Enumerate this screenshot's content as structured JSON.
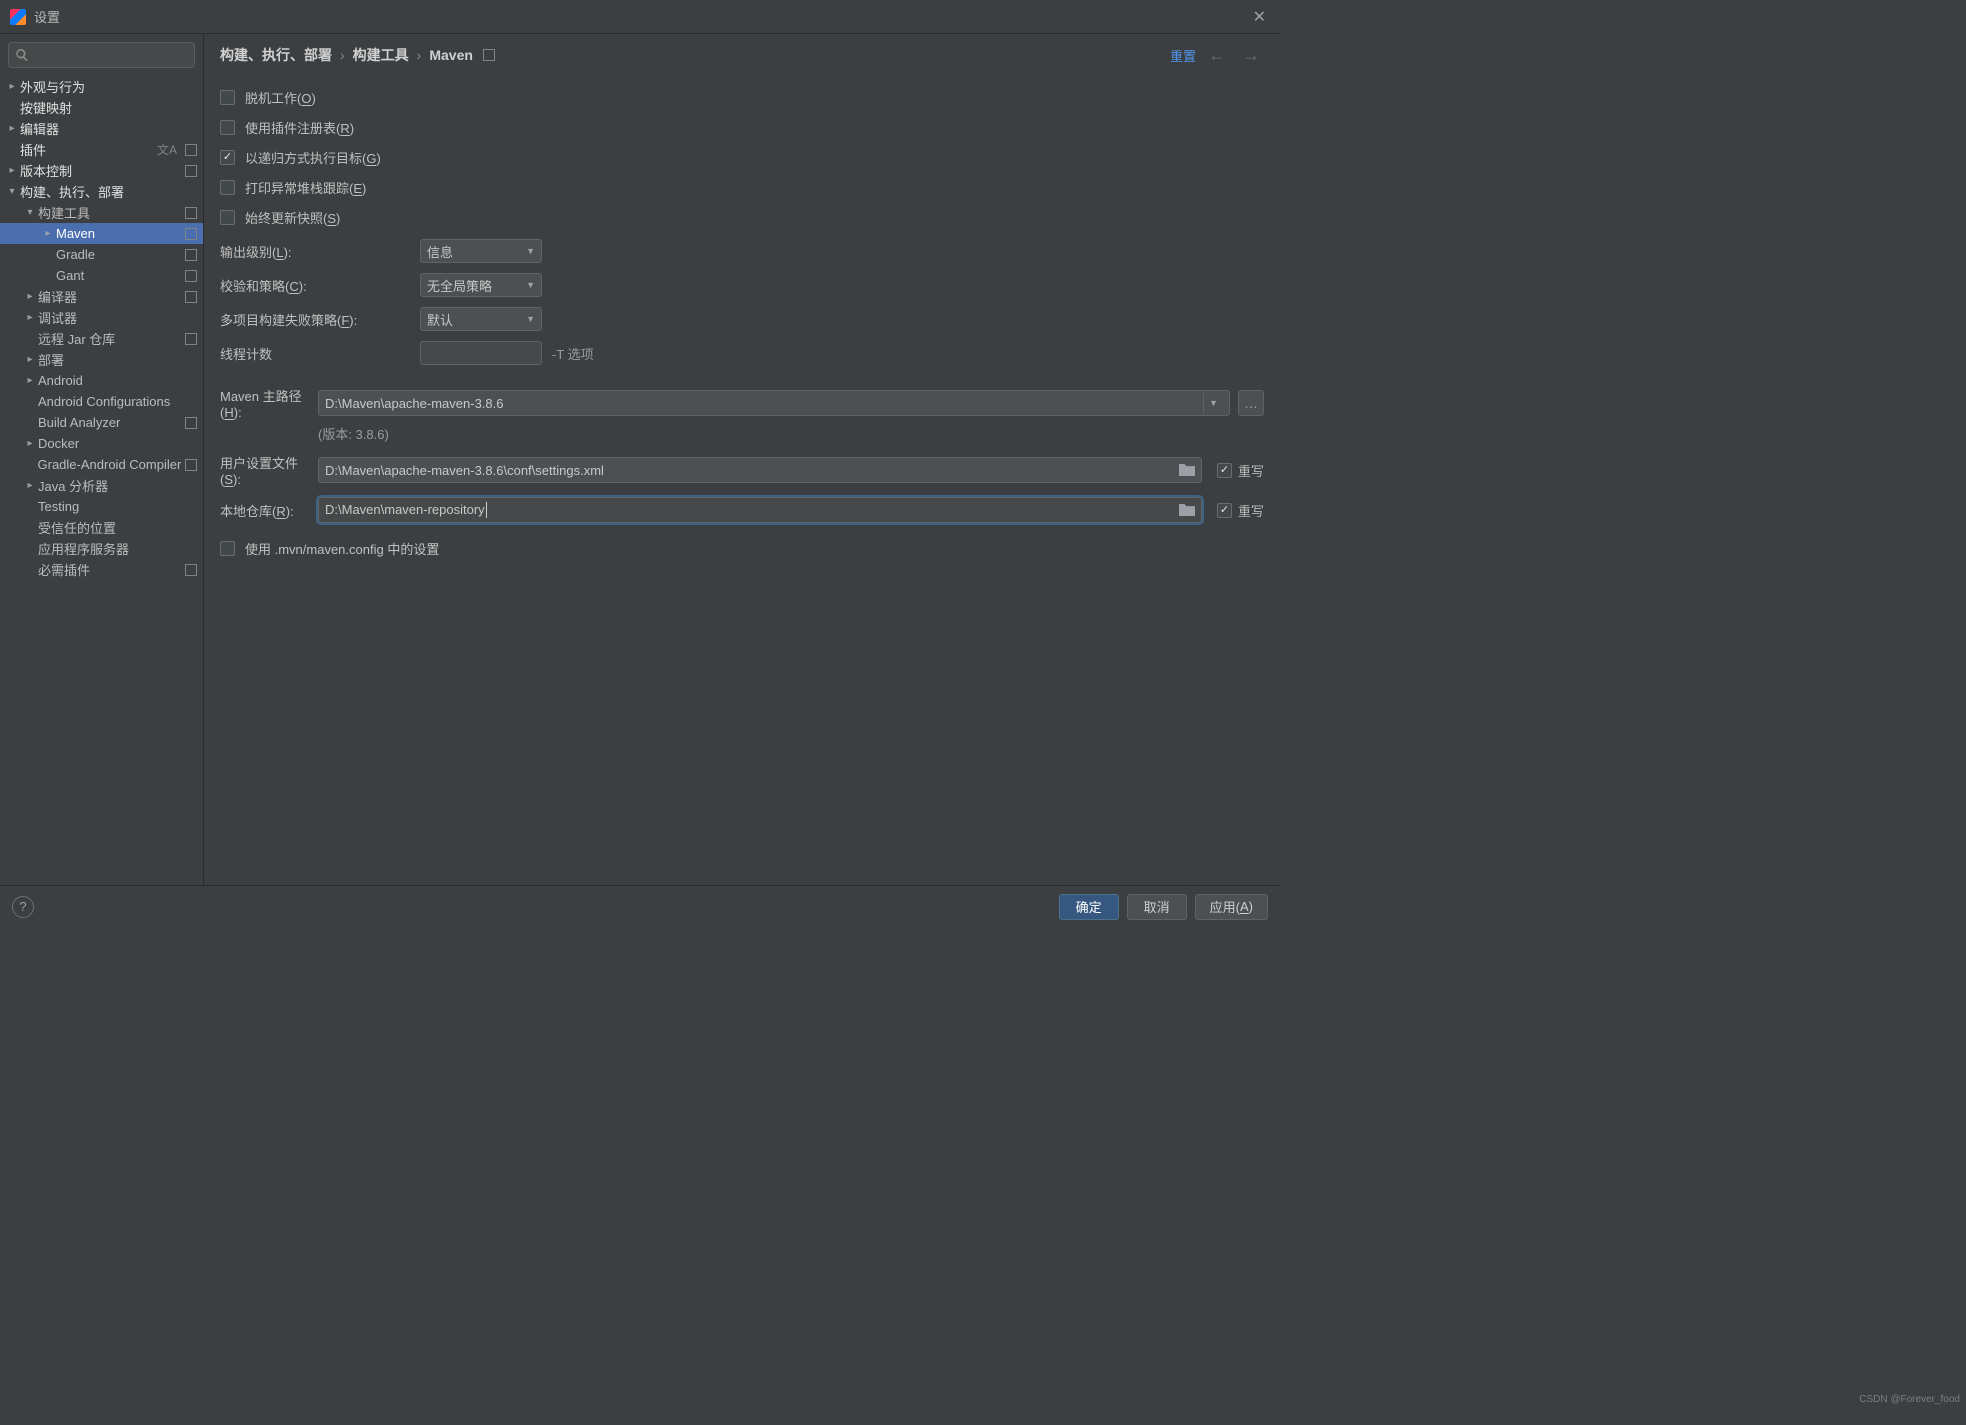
{
  "window": {
    "title": "设置"
  },
  "search": {
    "placeholder": ""
  },
  "sidebar": {
    "items": [
      {
        "label": "外观与行为",
        "arrow": "collapsed",
        "indent": 0,
        "bold": true
      },
      {
        "label": "按键映射",
        "arrow": "leaf",
        "indent": 0,
        "bold": true
      },
      {
        "label": "编辑器",
        "arrow": "collapsed",
        "indent": 0,
        "bold": true
      },
      {
        "label": "插件",
        "arrow": "leaf",
        "indent": 0,
        "bold": true,
        "lang": true,
        "badge": true
      },
      {
        "label": "版本控制",
        "arrow": "collapsed",
        "indent": 0,
        "bold": true,
        "badge": true
      },
      {
        "label": "构建、执行、部署",
        "arrow": "expanded",
        "indent": 0,
        "bold": true
      },
      {
        "label": "构建工具",
        "arrow": "expanded",
        "indent": 1,
        "badge": true
      },
      {
        "label": "Maven",
        "arrow": "collapsed",
        "indent": 2,
        "selected": true,
        "badge": true
      },
      {
        "label": "Gradle",
        "arrow": "leaf",
        "indent": 2,
        "badge": true
      },
      {
        "label": "Gant",
        "arrow": "leaf",
        "indent": 2,
        "badge": true
      },
      {
        "label": "编译器",
        "arrow": "collapsed",
        "indent": 1,
        "badge": true
      },
      {
        "label": "调试器",
        "arrow": "collapsed",
        "indent": 1
      },
      {
        "label": "远程 Jar 仓库",
        "arrow": "leaf",
        "indent": 1,
        "badge": true
      },
      {
        "label": "部署",
        "arrow": "collapsed",
        "indent": 1
      },
      {
        "label": "Android",
        "arrow": "collapsed",
        "indent": 1
      },
      {
        "label": "Android Configurations",
        "arrow": "leaf",
        "indent": 1
      },
      {
        "label": "Build Analyzer",
        "arrow": "leaf",
        "indent": 1,
        "badge": true
      },
      {
        "label": "Docker",
        "arrow": "collapsed",
        "indent": 1
      },
      {
        "label": "Gradle-Android Compiler",
        "arrow": "leaf",
        "indent": 1,
        "badge": true
      },
      {
        "label": "Java 分析器",
        "arrow": "collapsed",
        "indent": 1
      },
      {
        "label": "Testing",
        "arrow": "leaf",
        "indent": 1
      },
      {
        "label": "受信任的位置",
        "arrow": "leaf",
        "indent": 1
      },
      {
        "label": "应用程序服务器",
        "arrow": "leaf",
        "indent": 1
      },
      {
        "label": "必需插件",
        "arrow": "leaf",
        "indent": 1,
        "badge": true
      }
    ]
  },
  "breadcrumb": {
    "parts": [
      "构建、执行、部署",
      "构建工具",
      "Maven"
    ],
    "sep": "›"
  },
  "reset_label": "重置",
  "checks": {
    "offline": {
      "label": "脱机工作(",
      "mn": "O",
      "tail": ")",
      "checked": false
    },
    "registry": {
      "label": "使用插件注册表(",
      "mn": "R",
      "tail": ")",
      "checked": false
    },
    "recursive": {
      "label": "以递归方式执行目标(",
      "mn": "G",
      "tail": ")",
      "checked": true
    },
    "stacktrace": {
      "label": "打印异常堆栈跟踪(",
      "mn": "E",
      "tail": ")",
      "checked": false
    },
    "snapshots": {
      "label": "始终更新快照(",
      "mn": "S",
      "tail": ")",
      "checked": false
    },
    "mvnconfig": {
      "label": "使用 .mvn/maven.config 中的设置",
      "checked": false
    }
  },
  "fields": {
    "output_level": {
      "label": "输出级别(",
      "mn": "L",
      "tail": "):",
      "value": "信息"
    },
    "checksum": {
      "label": "校验和策略(",
      "mn": "C",
      "tail": "):",
      "value": "无全局策略"
    },
    "failpolicy": {
      "label": "多项目构建失败策略(",
      "mn": "F",
      "tail": "):",
      "value": "默认"
    },
    "threads": {
      "label": "线程计数",
      "value": "",
      "hint": "-T 选项"
    },
    "home": {
      "label": "Maven 主路径(",
      "mn": "H",
      "tail": "):",
      "value": "D:\\Maven\\apache-maven-3.8.6"
    },
    "version": "(版本: 3.8.6)",
    "settings": {
      "label": "用户设置文件(",
      "mn": "S",
      "tail": "):",
      "value": "D:\\Maven\\apache-maven-3.8.6\\conf\\settings.xml"
    },
    "repo": {
      "label": "本地仓库(",
      "mn": "R",
      "tail": "):",
      "value": "D:\\Maven\\maven-repository"
    },
    "override_label": "重写"
  },
  "buttons": {
    "ok": "确定",
    "cancel": "取消",
    "apply_pre": "应用(",
    "apply_mn": "A",
    "apply_post": ")",
    "more": "…"
  },
  "watermark": "CSDN @Forever_food"
}
